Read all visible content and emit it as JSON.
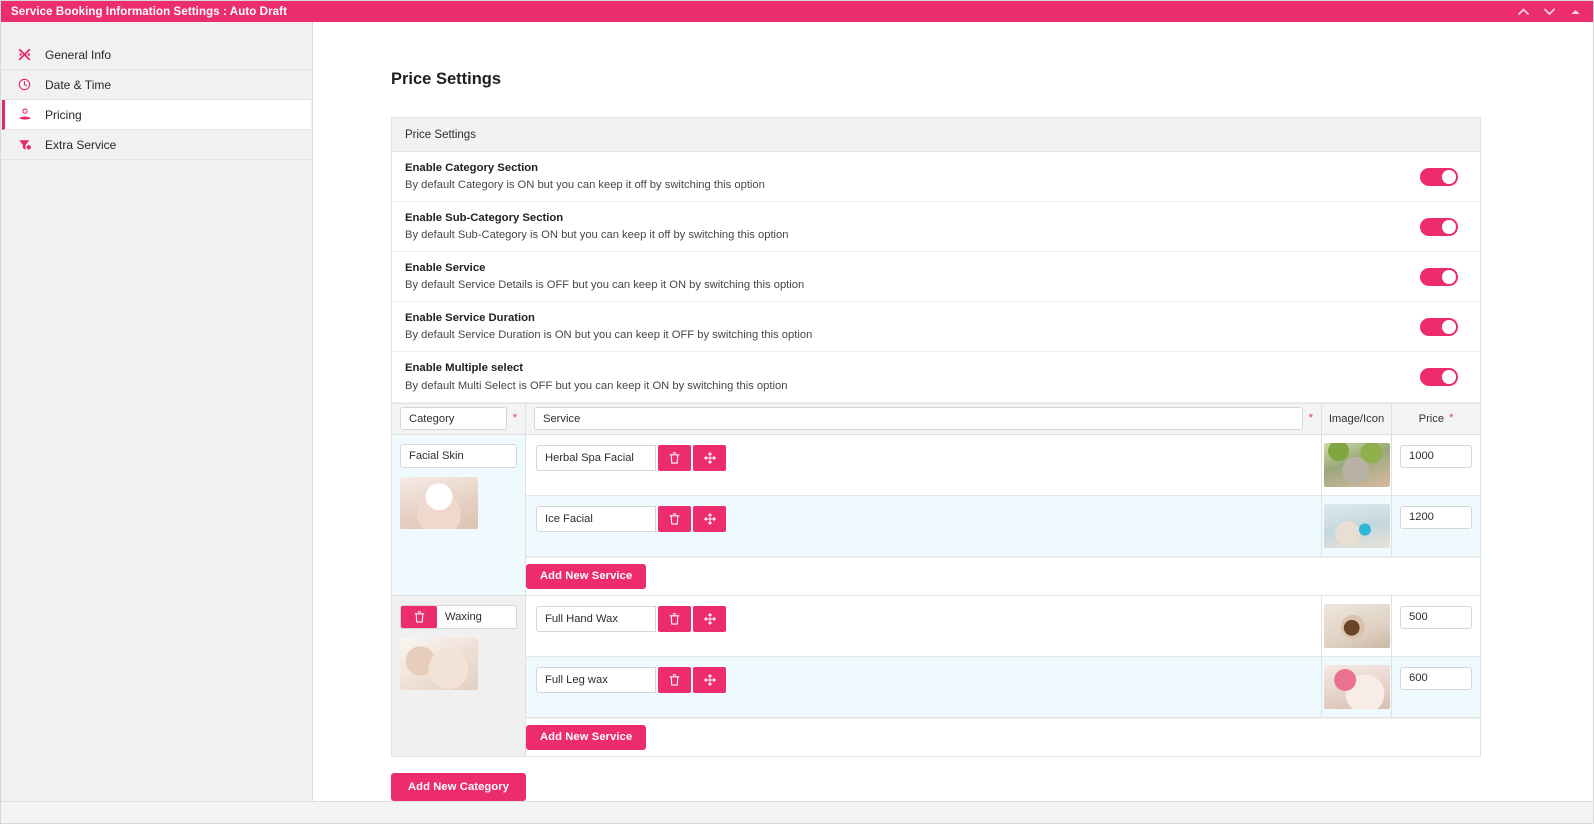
{
  "window": {
    "title": "Service Booking Information Settings : Auto Draft",
    "accent": "#ed2e6e",
    "controls": [
      {
        "name": "collapse-up",
        "glyph": "chevron-up"
      },
      {
        "name": "expand-down",
        "glyph": "chevron-down"
      },
      {
        "name": "close",
        "glyph": "caret-up"
      }
    ]
  },
  "sidebar": {
    "items": [
      {
        "label": "General Info",
        "icon": "scissors-icon",
        "active": false
      },
      {
        "label": "Date & Time",
        "icon": "clock-icon",
        "active": false
      },
      {
        "label": "Pricing",
        "icon": "hand-coin-icon",
        "active": true
      },
      {
        "label": "Extra Service",
        "icon": "funnel-badge-icon",
        "active": false
      }
    ]
  },
  "main": {
    "page_title": "Price Settings",
    "panel_header": "Price Settings",
    "options": [
      {
        "title": "Enable Category Section",
        "desc": "By default Category is ON but you can keep it off by switching this option",
        "state": "on"
      },
      {
        "title": "Enable Sub-Category Section",
        "desc": "By default Sub-Category is ON but you can keep it off by switching this option",
        "state": "on"
      },
      {
        "title": "Enable Service",
        "desc": "By default Service Details is OFF but you can keep it ON by switching this option",
        "state": "on"
      },
      {
        "title": "Enable Service Duration",
        "desc": "By default Service Duration is ON but you can keep it OFF by switching this option",
        "state": "on"
      },
      {
        "title": "Enable Multiple select",
        "desc": "By default Multi Select is OFF but you can keep it ON by switching this option",
        "state": "on"
      }
    ],
    "table": {
      "headers": {
        "category": "Category",
        "category_required": "*",
        "service": "Service",
        "service_required": "*",
        "image": "Image/Icon",
        "price": "Price",
        "price_required": "*"
      },
      "add_service_label": "Add New Service",
      "add_category_label": "Add New Category",
      "categories": [
        {
          "name": "Facial  Skin",
          "has_delete": false,
          "thumb_class": "art-skin",
          "services": [
            {
              "name": "Herbal Spa Facial",
              "price": "1000",
              "thumb_class": "art-facial",
              "alt": false
            },
            {
              "name": "Ice Facial",
              "price": "1200",
              "thumb_class": "art-ice",
              "alt": true
            }
          ]
        },
        {
          "name": "Waxing",
          "has_delete": true,
          "thumb_class": "art-waxing",
          "services": [
            {
              "name": "Full Hand Wax",
              "price": "500",
              "thumb_class": "art-hand",
              "alt": false
            },
            {
              "name": "Full Leg wax",
              "price": "600",
              "thumb_class": "art-leg",
              "alt": true
            }
          ]
        }
      ],
      "row_actions": [
        {
          "name": "delete-service-button",
          "icon": "trash-icon"
        },
        {
          "name": "move-service-button",
          "icon": "arrows-move-icon"
        }
      ]
    }
  }
}
